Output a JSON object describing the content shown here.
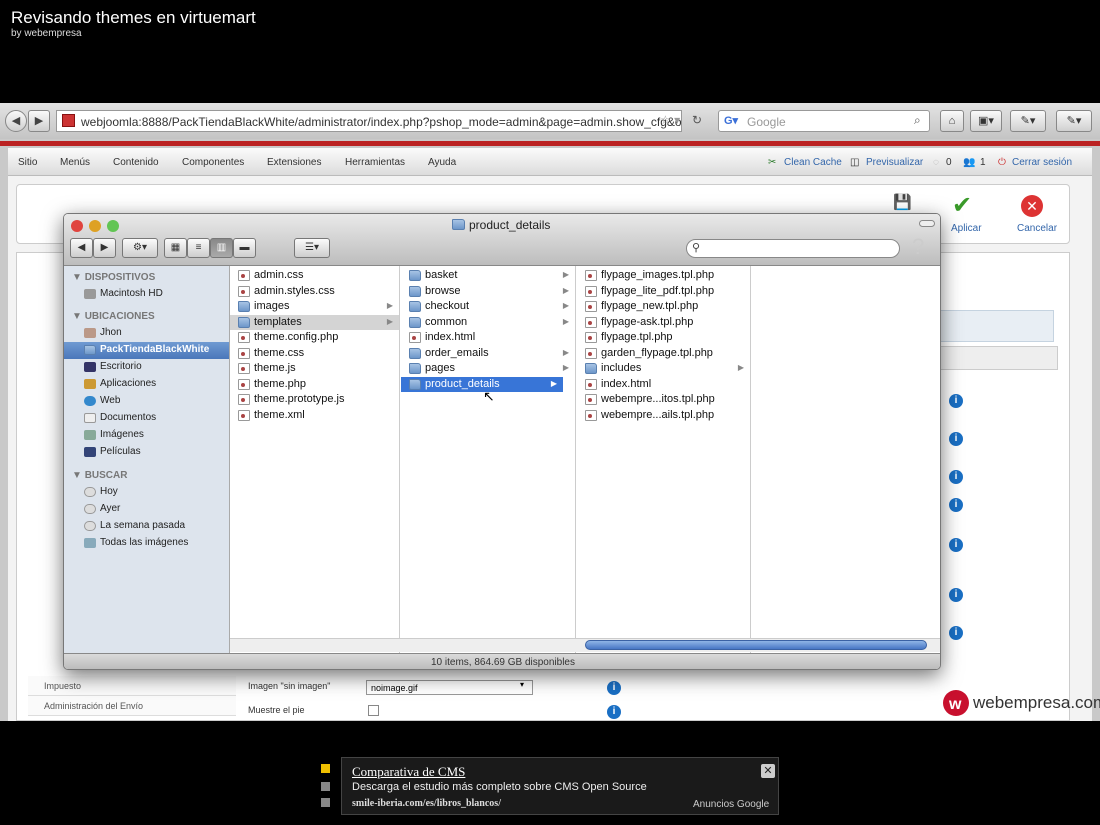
{
  "video": {
    "title": "Revisando themes en virtuemart",
    "byline": "by webempresa"
  },
  "browser": {
    "url": "webjoomla:8888/PackTiendaBlackWhite/administrator/index.php?pshop_mode=admin&page=admin.show_cfg&o",
    "search_placeholder": "Google"
  },
  "joomla": {
    "menu": [
      "Sitio",
      "Menús",
      "Contenido",
      "Componentes",
      "Extensiones",
      "Herramientas",
      "Ayuda"
    ],
    "menu_right": {
      "clean_cache": "Clean Cache",
      "preview": "Previsualizar",
      "count1": "0",
      "count2": "1",
      "logout": "Cerrar sesión"
    },
    "toolbar": {
      "apply": "Aplicar",
      "cancel": "Cancelar"
    },
    "sidebar_visible": [
      "Impuesto",
      "Administración del Envío"
    ],
    "form": {
      "noimage_label": "Imagen \"sin imagen\"",
      "noimage_value": "noimage.gif",
      "footer_label": "Muestre el pie"
    }
  },
  "finder": {
    "title": "product_details",
    "status": "10 items, 864.69 GB disponibles",
    "sidebar": {
      "devices_header": "DISPOSITIVOS",
      "devices": [
        "Macintosh HD"
      ],
      "places_header": "UBICACIONES",
      "places": [
        "Jhon",
        "PackTiendaBlackWhite",
        "Escritorio",
        "Aplicaciones",
        "Web",
        "Documentos",
        "Imágenes",
        "Películas"
      ],
      "search_header": "BUSCAR",
      "search": [
        "Hoy",
        "Ayer",
        "La semana pasada",
        "Todas las imágenes"
      ]
    },
    "col1": [
      "admin.css",
      "admin.styles.css",
      "images",
      "templates",
      "theme.config.php",
      "theme.css",
      "theme.js",
      "theme.php",
      "theme.prototype.js",
      "theme.xml"
    ],
    "col2": [
      "basket",
      "browse",
      "checkout",
      "common",
      "index.html",
      "order_emails",
      "pages",
      "product_details"
    ],
    "col3": [
      "flypage_images.tpl.php",
      "flypage_lite_pdf.tpl.php",
      "flypage_new.tpl.php",
      "flypage-ask.tpl.php",
      "flypage.tpl.php",
      "garden_flypage.tpl.php",
      "includes",
      "index.html",
      "webempre...itos.tpl.php",
      "webempre...ails.tpl.php"
    ]
  },
  "watermark": "webempresa.com",
  "ad": {
    "title": "Comparativa de CMS",
    "text": "Descarga el estudio más completo sobre CMS Open Source",
    "url": "smile-iberia.com/es/libros_blancos/",
    "brand": "Anuncios Google"
  },
  "colors": {
    "accent": "#3875d7",
    "joomla_red": "#b22222",
    "info": "#1a6fc4"
  }
}
